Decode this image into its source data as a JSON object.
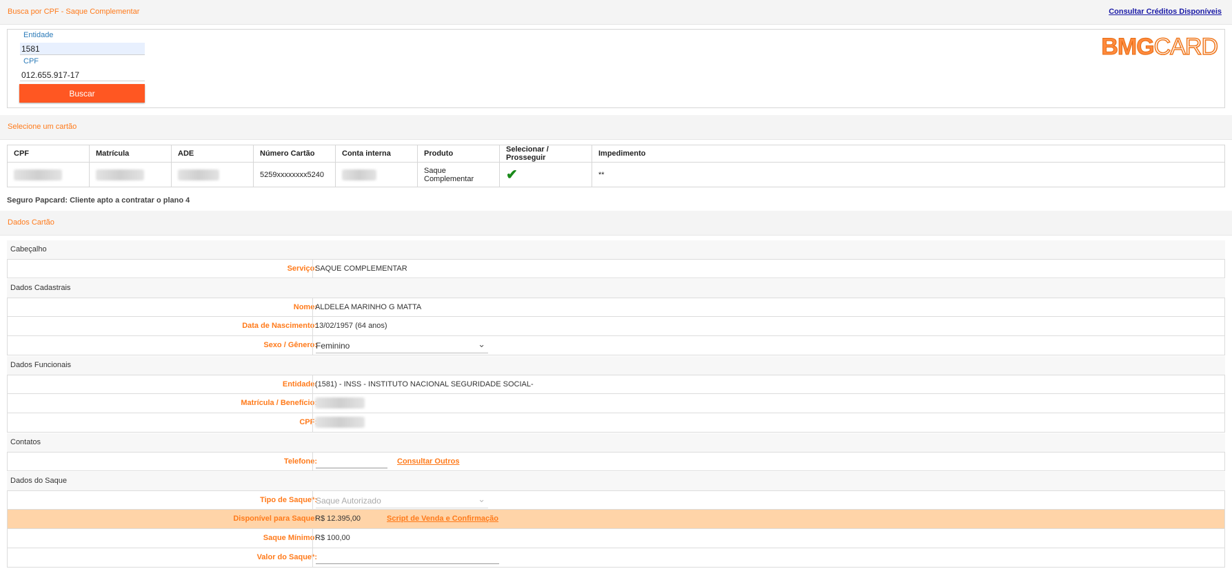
{
  "header": {
    "title": "Busca por CPF - Saque Complementar",
    "link": "Consultar Créditos Disponíveis"
  },
  "search": {
    "entidade_label": "Entidade",
    "entidade_value": "1581",
    "cpf_label": "CPF",
    "cpf_value": "012.655.917-17",
    "button": "Buscar",
    "logo_left": "BMG",
    "logo_right": "CARD"
  },
  "select_card": {
    "title": "Selecione um cartão",
    "columns": [
      "CPF",
      "Matrícula",
      "ADE",
      "Número Cartão",
      "Conta interna",
      "Produto",
      "Selecionar / Prosseguir",
      "Impedimento"
    ],
    "row": {
      "numero_cartao": "5259xxxxxxxx5240",
      "produto": "Saque Complementar",
      "select_icon": "check-icon",
      "impedimento": "**"
    }
  },
  "seguro_text": "Seguro Papcard: Cliente apto a contratar o plano 4",
  "dados_cartao": {
    "title": "Dados Cartão",
    "cabecalho": {
      "head": "Cabeçalho",
      "servico_label": "Serviço:",
      "servico_value": "SAQUE COMPLEMENTAR"
    },
    "cadastrais": {
      "head": "Dados Cadastrais",
      "nome_label": "Nome:",
      "nome_value": "ALDELEA MARINHO G MATTA",
      "nasc_label": "Data de Nascimento:",
      "nasc_value": "13/02/1957 (64 anos)",
      "sexo_label": "Sexo / Gênero:",
      "sexo_value": "Feminino"
    },
    "funcionais": {
      "head": "Dados Funcionais",
      "entidade_label": "Entidade:",
      "entidade_value": "(1581) - INSS - INSTITUTO NACIONAL SEGURIDADE SOCIAL-",
      "matricula_label": "Matrícula / Benefício:",
      "cpf_label": "CPF:"
    },
    "contatos": {
      "head": "Contatos",
      "telefone_label": "Telefone:",
      "consultar_outros": "Consultar Outros"
    },
    "saque": {
      "head": "Dados do Saque",
      "tipo_label": "Tipo de Saque*:",
      "tipo_value": "Saque Autorizado",
      "disponivel_label": "Disponível para Saque:",
      "disponivel_value": "R$ 12.395,00",
      "script_link": "Script de Venda e Confirmação",
      "minimo_label": "Saque Mínimo:",
      "minimo_value": "R$ 100,00",
      "valor_label": "Valor do Saque*:"
    }
  },
  "colors": {
    "accent": "#ff7a1a",
    "button": "#ff5722",
    "highlight_row": "#ffd4a8",
    "link": "#1a1aa6"
  }
}
